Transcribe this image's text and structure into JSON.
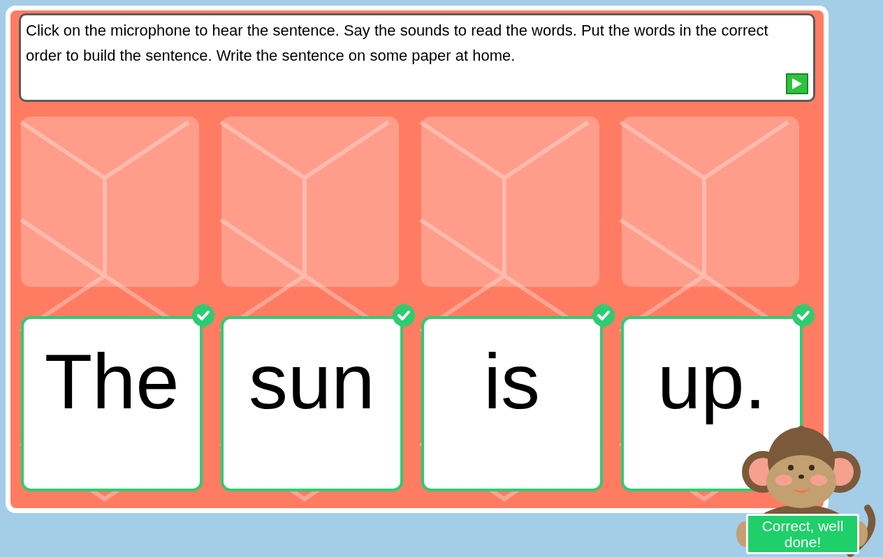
{
  "instructions": {
    "text": "Click on the microphone to hear the sentence. Say the sounds to read the words. Put the words in the correct order to build the sentence. Write the sentence on some paper at home."
  },
  "slots": [
    {
      "filled": false
    },
    {
      "filled": false
    },
    {
      "filled": false
    },
    {
      "filled": false
    }
  ],
  "words": [
    {
      "text": "The",
      "correct": true
    },
    {
      "text": "sun",
      "correct": true
    },
    {
      "text": "is",
      "correct": true
    },
    {
      "text": "up.",
      "correct": true
    }
  ],
  "feedback": {
    "text": "Correct, well done!"
  }
}
